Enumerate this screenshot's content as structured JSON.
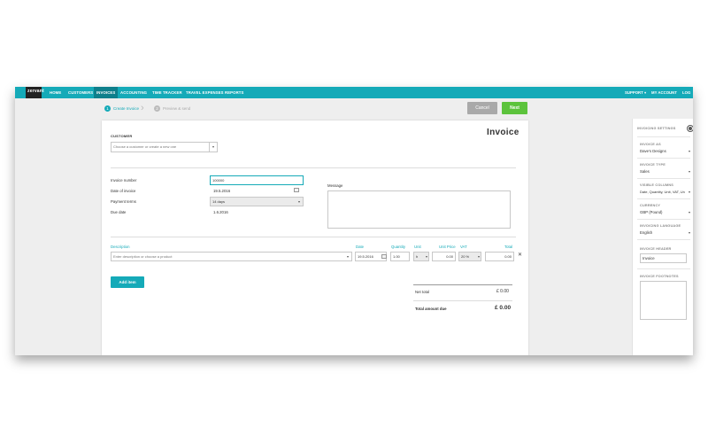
{
  "nav": {
    "logo": "zervant",
    "items": [
      "HOME",
      "CUSTOMERS",
      "INVOICES",
      "ACCOUNTING",
      "TIME TRACKER",
      "TRAVEL EXPENSES",
      "REPORTS"
    ],
    "active_index": 2,
    "right": [
      "SUPPORT",
      "MY ACCOUNT",
      "LOG"
    ]
  },
  "steps": [
    {
      "number": "1",
      "label": "Create Invoice",
      "active": true
    },
    {
      "number": "2",
      "label": "Preview & send",
      "active": false
    }
  ],
  "buttons": {
    "cancel": "Cancel",
    "next": "Next",
    "add_item": "Add item"
  },
  "invoice": {
    "title": "Invoice",
    "customer_label": "CUSTOMER",
    "customer_placeholder": "Choose a customer or create a new one",
    "invoice_number_label": "Invoice number",
    "invoice_number_value": "100000",
    "date_label": "Date of invoice",
    "date_value": "19.5.2016",
    "payment_terms_label": "Payment terms",
    "payment_terms_value": "14 days",
    "due_date_label": "Due date",
    "due_date_value": "1.6.2016",
    "message_label": "Message",
    "columns": [
      "Description",
      "Date",
      "Quantity",
      "Unit",
      "Unit Price",
      "VAT",
      "Total"
    ],
    "row": {
      "description_placeholder": "Enter description or choose a product",
      "date": "19.5.2016",
      "quantity": "1.00",
      "unit": "h",
      "unit_price": "0.00",
      "vat": "20 %",
      "total": "0.00"
    },
    "net_total_label": "Net total",
    "net_total_value": "£ 0.00",
    "total_due_label": "Total amount due",
    "total_due_value": "£ 0.00"
  },
  "settings": {
    "title": "INVOICING SETTINGS",
    "fields": [
      {
        "label": "INVOICE AS",
        "value": "Dave's Designs"
      },
      {
        "label": "INVOICE TYPE",
        "value": "Sales"
      },
      {
        "label": "VISIBLE COLUMNS",
        "value": "Date, Quantity, Unit, VAT, Un"
      },
      {
        "label": "CURRENCY",
        "value": "GBP (Pound)"
      },
      {
        "label": "INVOICING LANGUAGE",
        "value": "English"
      },
      {
        "label": "INVOICE HEADER",
        "value": "Invoice"
      },
      {
        "label": "INVOICE FOOTNOTES",
        "value": ""
      }
    ]
  },
  "colors": {
    "teal": "#15aab8",
    "green": "#5cc33c",
    "gray": "#a9a9a9"
  }
}
